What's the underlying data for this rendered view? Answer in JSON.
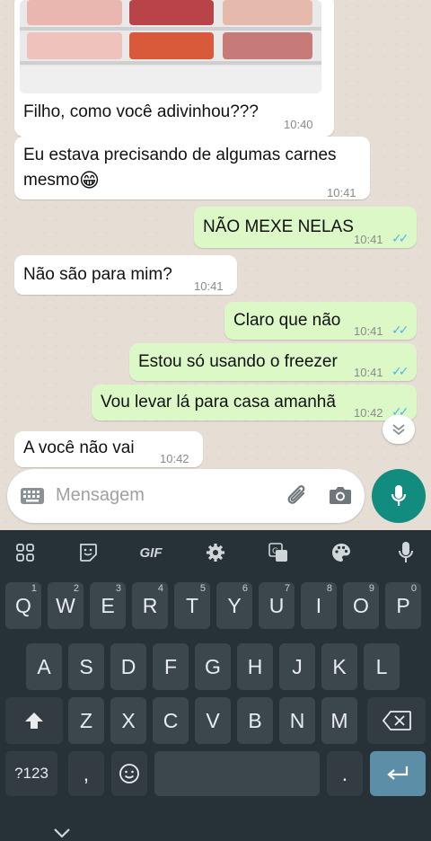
{
  "messages": [
    {
      "text": "Filho, como você adivinhou???",
      "time": "10:40"
    },
    {
      "text": "Eu estava precisando de algumas carnes",
      "text2": "mesmo",
      "time": "10:41"
    },
    {
      "text": "NÃO MEXE NELAS",
      "time": "10:41"
    },
    {
      "text": "Não são para mim?",
      "time": "10:41"
    },
    {
      "text": "Claro que não",
      "time": "10:41"
    },
    {
      "text": "Estou só usando o freezer",
      "time": "10:41"
    },
    {
      "text": "Vou levar lá para casa amanhã",
      "time": "10:42"
    },
    {
      "text": "A você não vai",
      "time": "10:42"
    }
  ],
  "emoji": "😁",
  "input": {
    "placeholder": "Mensagem"
  },
  "toolbar": {
    "gif_label": "GIF"
  },
  "keyboard": {
    "row1": [
      {
        "k": "Q",
        "h": "1"
      },
      {
        "k": "W",
        "h": "2"
      },
      {
        "k": "E",
        "h": "3"
      },
      {
        "k": "R",
        "h": "4"
      },
      {
        "k": "T",
        "h": "5"
      },
      {
        "k": "Y",
        "h": "6"
      },
      {
        "k": "U",
        "h": "7"
      },
      {
        "k": "I",
        "h": "8"
      },
      {
        "k": "O",
        "h": "9"
      },
      {
        "k": "P",
        "h": "0"
      }
    ],
    "row2": [
      "A",
      "S",
      "D",
      "F",
      "G",
      "H",
      "J",
      "K",
      "L"
    ],
    "row3": [
      "Z",
      "X",
      "C",
      "V",
      "B",
      "N",
      "M"
    ],
    "symbols": "?123",
    "comma": ",",
    "period": "."
  },
  "colors": {
    "accent": "#128c7e",
    "outgoing": "#dcf8c6",
    "read_ticks": "#4fb6ec",
    "keyboard_bg": "#273238"
  }
}
